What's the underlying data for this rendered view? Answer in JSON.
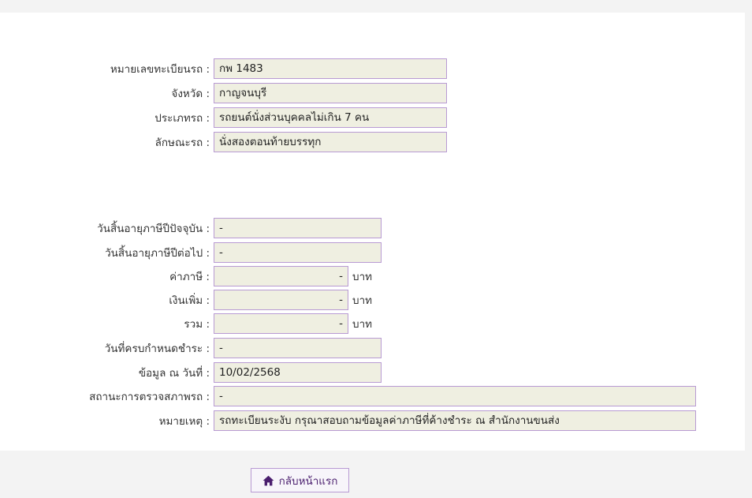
{
  "vehicle": {
    "plate_label": "หมายเลขทะเบียนรถ :",
    "plate_value": "กพ 1483",
    "province_label": "จังหวัด :",
    "province_value": "กาญจนบุรี",
    "type_label": "ประเภทรถ :",
    "type_value": "รถยนต์นั่งส่วนบุคคลไม่เกิน 7 คน",
    "body_label": "ลักษณะรถ :",
    "body_value": "นั่งสองตอนท้ายบรรทุก"
  },
  "tax": {
    "current_expiry_label": "วันสิ้นอายุภาษีปีปัจจุบัน :",
    "current_expiry_value": "-",
    "next_expiry_label": "วันสิ้นอายุภาษีปีต่อไป :",
    "next_expiry_value": "-",
    "tax_label": "ค่าภาษี :",
    "tax_value": "-",
    "surcharge_label": "เงินเพิ่ม :",
    "surcharge_value": "-",
    "total_label": "รวม :",
    "total_value": "-",
    "unit": "บาท",
    "due_date_label": "วันที่ครบกำหนดชำระ :",
    "due_date_value": "-",
    "data_date_label": "ข้อมูล ณ วันที่ :",
    "data_date_value": "10/02/2568",
    "inspection_label": "สถานะการตรวจสภาพรถ :",
    "inspection_value": "-",
    "remark_label": "หมายเหตุ :",
    "remark_value": "รถทะเบียนระงับ กรุณาสอบถามข้อมูลค่าภาษีที่ค้างชำระ ณ สำนักงานขนส่ง"
  },
  "actions": {
    "home_label": "กลับหน้าแรก",
    "home_icon": "home-icon",
    "accent_color": "#4a1e6e"
  }
}
